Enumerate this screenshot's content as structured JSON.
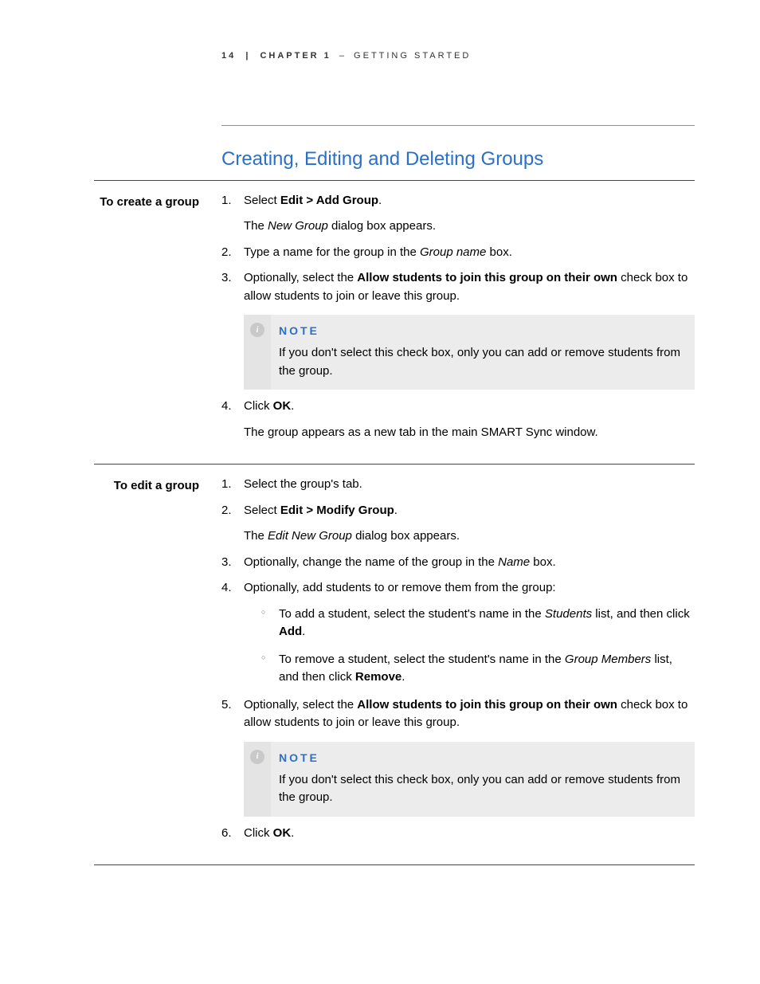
{
  "header": {
    "page_number": "14",
    "separator": "|",
    "chapter": "CHAPTER 1",
    "dash": "–",
    "chapter_title": "GETTING STARTED"
  },
  "section_title": "Creating, Editing and Deleting Groups",
  "note_label": "NOTE",
  "create": {
    "label": "To create a group",
    "step1_pre": "Select ",
    "step1_bold": "Edit > Add Group",
    "step1_post": ".",
    "step1_sub_pre": "The ",
    "step1_sub_em": "New Group",
    "step1_sub_post": " dialog box appears.",
    "step2_pre": "Type a name for the group in the ",
    "step2_em": "Group name",
    "step2_post": " box.",
    "step3_pre": "Optionally, select the ",
    "step3_bold": "Allow students to join this group on their own",
    "step3_post": " check box to allow students to join or leave this group.",
    "note_text": "If you don't select this check box, only you can add or remove students from the group.",
    "step4_pre": "Click ",
    "step4_bold": "OK",
    "step4_post": ".",
    "step4_sub": "The group appears as a new tab in the main SMART Sync window."
  },
  "edit": {
    "label": "To edit a group",
    "step1": "Select the group's tab.",
    "step2_pre": "Select ",
    "step2_bold": "Edit > Modify Group",
    "step2_post": ".",
    "step2_sub_pre": "The ",
    "step2_sub_em": "Edit New Group",
    "step2_sub_post": " dialog box appears.",
    "step3_pre": "Optionally, change the name of the group in the ",
    "step3_em": "Name",
    "step3_post": " box.",
    "step4": "Optionally, add students to or remove them from the group:",
    "step4_b1_pre": "To add a student, select the student's name in the ",
    "step4_b1_em": "Students",
    "step4_b1_mid": " list, and then click ",
    "step4_b1_bold": "Add",
    "step4_b1_post": ".",
    "step4_b2_pre": "To remove a student, select the student's name in the ",
    "step4_b2_em": "Group Members",
    "step4_b2_mid": " list, and then click ",
    "step4_b2_bold": "Remove",
    "step4_b2_post": ".",
    "step5_pre": "Optionally, select the ",
    "step5_bold": "Allow students to join this group on their own",
    "step5_post": " check box to allow students to join or leave this group.",
    "note_text": "If you don't select this check box, only you can add or remove students from the group.",
    "step6_pre": "Click ",
    "step6_bold": "OK",
    "step6_post": "."
  }
}
